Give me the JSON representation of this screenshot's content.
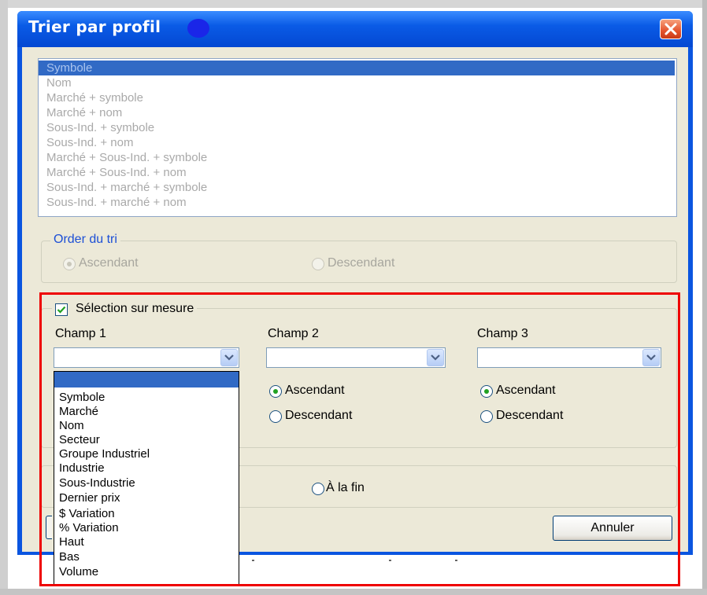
{
  "window": {
    "title": "Trier par profil"
  },
  "profile_list": {
    "items": [
      "Symbole",
      "Nom",
      "Marché + symbole",
      "Marché + nom",
      "Sous-Ind. + symbole",
      "Sous-Ind. + nom",
      "Marché + Sous-Ind. + symbole",
      "Marché + Sous-Ind. + nom",
      "Sous-Ind. + marché + symbole",
      "Sous-Ind. + marché + nom"
    ],
    "selected": "Symbole"
  },
  "sort_order": {
    "legend": "Order du tri",
    "ascending": "Ascendant",
    "descending": "Descendant",
    "selected": "Ascendant"
  },
  "custom_selection": {
    "label": "Sélection sur mesure",
    "checked": true,
    "fields": [
      {
        "label": "Champ 1",
        "value": ""
      },
      {
        "label": "Champ 2",
        "value": "",
        "ascending": "Ascendant",
        "descending": "Descendant",
        "selected": "Ascendant"
      },
      {
        "label": "Champ 3",
        "value": "",
        "ascending": "Ascendant",
        "descending": "Descendant",
        "selected": "Ascendant"
      }
    ]
  },
  "position": {
    "at_end": "À la fin"
  },
  "buttons": {
    "cancel": "Annuler"
  },
  "dropdown": {
    "items": [
      "",
      "Symbole",
      "Marché",
      "Nom",
      "Secteur",
      "Groupe Industriel",
      "Industrie",
      "Sous-Industrie",
      "Dernier prix",
      "$ Variation",
      "% Variation",
      "Haut",
      "Bas",
      "Volume"
    ]
  },
  "colors": {
    "titlebar": "#0a55e0",
    "selection": "#316ac5",
    "annotation": "#ee0000",
    "dialog_face": "#ece9d8"
  }
}
